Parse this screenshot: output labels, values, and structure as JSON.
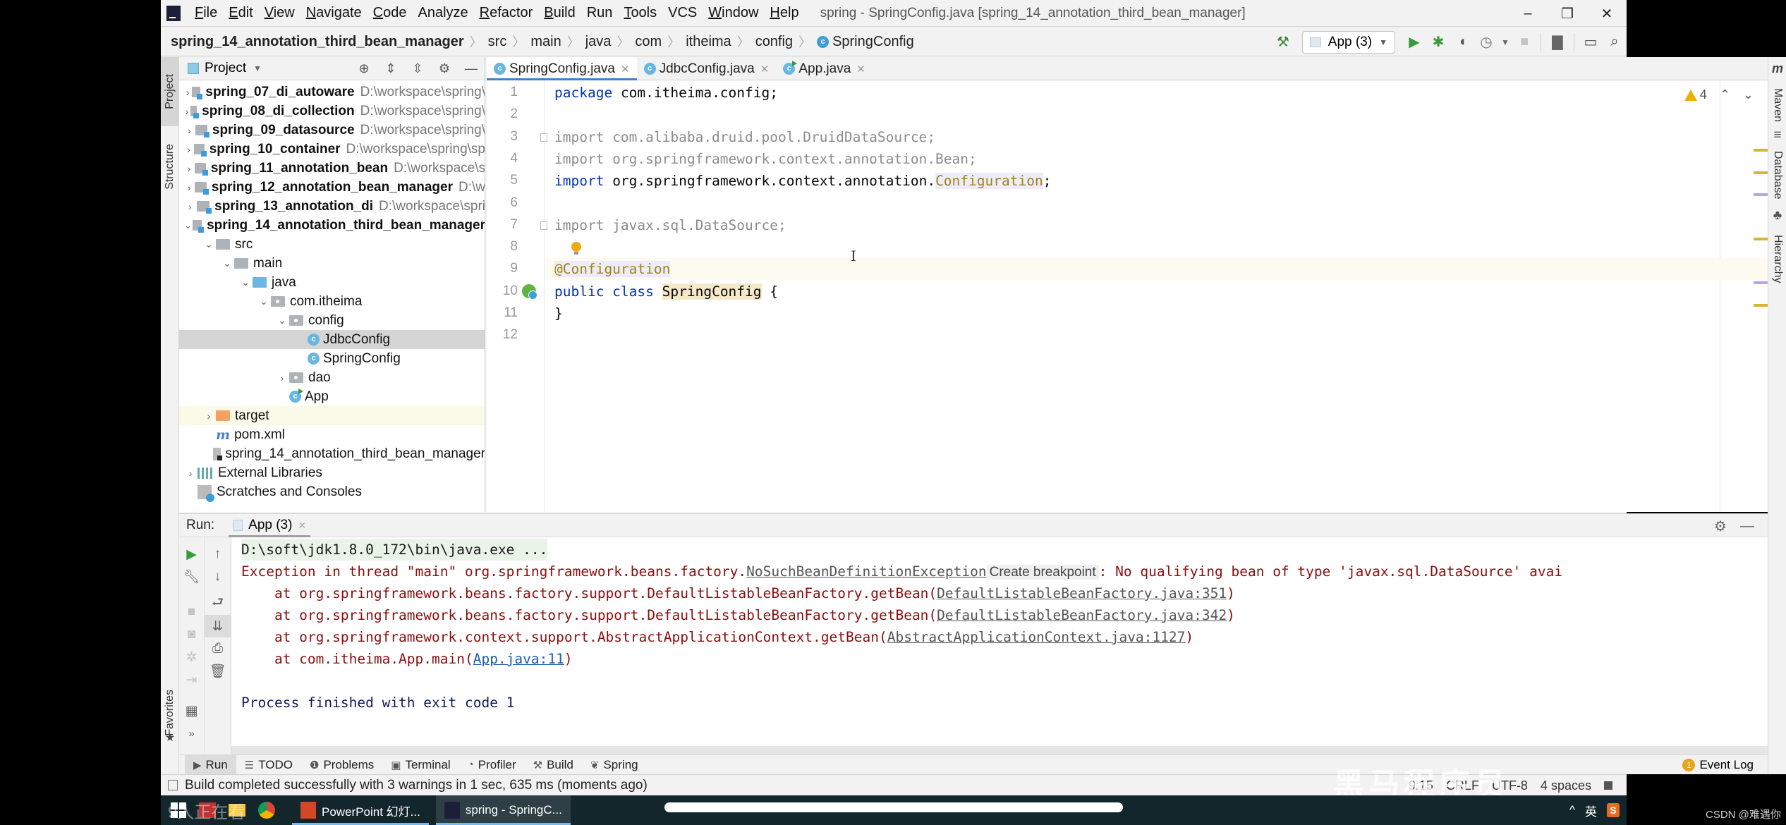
{
  "window": {
    "title": "spring - SpringConfig.java [spring_14_annotation_third_bean_manager]",
    "controls": {
      "minimize": "–",
      "restore": "❐",
      "close": "✕"
    }
  },
  "menu": [
    {
      "label": "File",
      "mnemonic": "F",
      "rest": "ile"
    },
    {
      "label": "Edit",
      "mnemonic": "E",
      "rest": "dit"
    },
    {
      "label": "View",
      "mnemonic": "V",
      "rest": "iew"
    },
    {
      "label": "Navigate",
      "mnemonic": "N",
      "rest": "avigate"
    },
    {
      "label": "Code",
      "mnemonic": "C",
      "rest": "ode"
    },
    {
      "label": "Analyze",
      "mnemonic": "",
      "rest": "Analyze"
    },
    {
      "label": "Refactor",
      "mnemonic": "R",
      "rest": "efactor"
    },
    {
      "label": "Build",
      "mnemonic": "B",
      "rest": "uild"
    },
    {
      "label": "Run",
      "mnemonic": "",
      "rest": "Run"
    },
    {
      "label": "Tools",
      "mnemonic": "T",
      "rest": "ools"
    },
    {
      "label": "VCS",
      "mnemonic": "",
      "rest": "VCS"
    },
    {
      "label": "Window",
      "mnemonic": "W",
      "rest": "indow"
    },
    {
      "label": "Help",
      "mnemonic": "H",
      "rest": "elp"
    }
  ],
  "breadcrumb": [
    "spring_14_annotation_third_bean_manager",
    "src",
    "main",
    "java",
    "com",
    "itheima",
    "config",
    "SpringConfig"
  ],
  "toolbar": {
    "run_config": "App (3)",
    "icons": [
      "build-hammer-icon",
      "run-icon",
      "debug-icon",
      "coverage-icon",
      "profile-icon",
      "stop-icon",
      "project-structure-icon",
      "run-anything-icon",
      "search-icon"
    ]
  },
  "left_stripe": {
    "project": "Project",
    "structure": "Structure",
    "favorites": "Favorites"
  },
  "right_stripe": {
    "maven": "Maven",
    "database": "Database",
    "hierarchy": "Hierarchy"
  },
  "project_panel": {
    "title": "Project",
    "tree": [
      {
        "name": "spring_07_di_autoware",
        "path": "D:\\workspace\\spring\\",
        "type": "module",
        "depth": 0,
        "arrow": "right"
      },
      {
        "name": "spring_08_di_collection",
        "path": "D:\\workspace\\spring\\",
        "type": "module",
        "depth": 0,
        "arrow": "right"
      },
      {
        "name": "spring_09_datasource",
        "path": "D:\\workspace\\spring\\",
        "type": "module",
        "depth": 0,
        "arrow": "right"
      },
      {
        "name": "spring_10_container",
        "path": "D:\\workspace\\spring\\sp",
        "type": "module",
        "depth": 0,
        "arrow": "right"
      },
      {
        "name": "spring_11_annotation_bean",
        "path": "D:\\workspace\\s",
        "type": "module",
        "depth": 0,
        "arrow": "right"
      },
      {
        "name": "spring_12_annotation_bean_manager",
        "path": "D:\\w",
        "type": "module",
        "depth": 0,
        "arrow": "right"
      },
      {
        "name": "spring_13_annotation_di",
        "path": "D:\\workspace\\spri",
        "type": "module",
        "depth": 0,
        "arrow": "right"
      },
      {
        "name": "spring_14_annotation_third_bean_manager",
        "path": "",
        "type": "module",
        "depth": 0,
        "arrow": "down"
      },
      {
        "name": "src",
        "type": "folder",
        "depth": 1,
        "arrow": "down"
      },
      {
        "name": "main",
        "type": "folder",
        "depth": 2,
        "arrow": "down"
      },
      {
        "name": "java",
        "type": "java",
        "depth": 3,
        "arrow": "down"
      },
      {
        "name": "com.itheima",
        "type": "pkg",
        "depth": 4,
        "arrow": "down"
      },
      {
        "name": "config",
        "type": "pkg",
        "depth": 5,
        "arrow": "down"
      },
      {
        "name": "JdbcConfig",
        "type": "class",
        "depth": 6,
        "arrow": "",
        "selected": true
      },
      {
        "name": "SpringConfig",
        "type": "class",
        "depth": 6,
        "arrow": ""
      },
      {
        "name": "dao",
        "type": "pkg",
        "depth": 5,
        "arrow": "right"
      },
      {
        "name": "App",
        "type": "runclass",
        "depth": 5,
        "arrow": ""
      },
      {
        "name": "target",
        "type": "target",
        "depth": 1,
        "arrow": "right",
        "excluded": true
      },
      {
        "name": "pom.xml",
        "type": "maven",
        "depth": 1,
        "arrow": ""
      },
      {
        "name": "spring_14_annotation_third_bean_manager",
        "type": "iml",
        "depth": 1,
        "arrow": ""
      },
      {
        "name": "External Libraries",
        "type": "lib",
        "depth": 0,
        "arrow": "right"
      },
      {
        "name": "Scratches and Consoles",
        "type": "scratch",
        "depth": 0,
        "arrow": ""
      }
    ]
  },
  "editor": {
    "tabs": [
      {
        "label": "SpringConfig.java",
        "active": true,
        "icon": "class"
      },
      {
        "label": "JdbcConfig.java",
        "active": false,
        "icon": "class"
      },
      {
        "label": "App.java",
        "active": false,
        "icon": "runclass"
      }
    ],
    "warnings_count": "4",
    "lines": [
      {
        "n": "1",
        "parts": [
          [
            "kw",
            "package"
          ],
          [
            "",
            " com.itheima.config;"
          ]
        ]
      },
      {
        "n": "2",
        "parts": []
      },
      {
        "n": "3",
        "parts": [
          [
            "imp-grey",
            "import com.alibaba.druid.pool.DruidDataSource;"
          ]
        ]
      },
      {
        "n": "4",
        "parts": [
          [
            "imp-grey",
            "import org.springframework.context.annotation.Bean;"
          ]
        ]
      },
      {
        "n": "5",
        "parts": [
          [
            "kw",
            "import"
          ],
          [
            "",
            " org.springframework.context.annotation."
          ],
          [
            "ann ann-bg",
            "Configuration"
          ],
          [
            "",
            ";"
          ]
        ]
      },
      {
        "n": "6",
        "parts": []
      },
      {
        "n": "7",
        "parts": [
          [
            "imp-grey",
            "import javax.sql.DataSource;"
          ]
        ]
      },
      {
        "n": "8",
        "parts": []
      },
      {
        "n": "9",
        "parts": [
          [
            "ann ann-bg",
            "@Configuration"
          ]
        ]
      },
      {
        "n": "10",
        "parts": [
          [
            "kw",
            "public class"
          ],
          [
            "",
            " "
          ],
          [
            "cls-hl",
            "SpringConfig"
          ],
          [
            "",
            " {"
          ]
        ]
      },
      {
        "n": "11",
        "parts": [
          [
            "",
            "}"
          ]
        ]
      },
      {
        "n": "12",
        "parts": []
      }
    ]
  },
  "run_panel": {
    "label": "Run:",
    "tab": "App (3)",
    "console": {
      "cmd": "D:\\soft\\jdk1.8.0_172\\bin\\java.exe ...",
      "exception_prefix": "Exception in thread \"main\" org.springframework.beans.factory.",
      "exception_class": "NoSuchBeanDefinitionException",
      "create_breakpoint": "Create breakpoint",
      "exception_msg": ": No qualifying bean of type 'javax.sql.DataSource' avai",
      "stack": [
        {
          "prefix": "    at org.springframework.beans.factory.support.DefaultListableBeanFactory.getBean(",
          "link": "DefaultListableBeanFactory.java:351",
          "suffix": ")"
        },
        {
          "prefix": "    at org.springframework.beans.factory.support.DefaultListableBeanFactory.getBean(",
          "link": "DefaultListableBeanFactory.java:342",
          "suffix": ")"
        },
        {
          "prefix": "    at org.springframework.context.support.AbstractApplicationContext.getBean(",
          "link": "AbstractApplicationContext.java:1127",
          "suffix": ")"
        },
        {
          "prefix": "    at com.itheima.App.main(",
          "link": "App.java:11",
          "suffix": ")"
        }
      ],
      "finished": "Process finished with exit code 1"
    }
  },
  "tool_tabs": [
    {
      "label": "Run",
      "icon": "▶",
      "active": true
    },
    {
      "label": "TODO",
      "icon": "☰"
    },
    {
      "label": "Problems",
      "icon": "❶"
    },
    {
      "label": "Terminal",
      "icon": "▣"
    },
    {
      "label": "Profiler",
      "icon": "◔"
    },
    {
      "label": "Build",
      "icon": "⚒"
    },
    {
      "label": "Spring",
      "icon": "❦"
    }
  ],
  "event_log": {
    "label": "Event Log",
    "count": "1"
  },
  "status_bar": {
    "message": "Build completed successfully with 3 warnings in 1 sec, 635 ms (moments ago)",
    "position": "9:15",
    "line_sep": "CRLF",
    "encoding": "UTF-8",
    "indent": "4 spaces"
  },
  "watermark": "黑马程序员",
  "taskbar": {
    "watchers": "9人正在看",
    "apps": [
      {
        "label": "PowerPoint 幻灯...",
        "active": false
      },
      {
        "label": "spring - SpringC...",
        "active": true
      }
    ],
    "tray": {
      "chevron": "^",
      "ime": "英",
      "sogou": "S"
    },
    "progress": 0.5
  },
  "corner_credit": "CSDN @难遇你",
  "colors": {
    "accent": "#4083c9",
    "keyword": "#0033b3",
    "annotation": "#9e880d",
    "error_text": "#8c0d0d",
    "run_green": "#3a9a3a"
  }
}
